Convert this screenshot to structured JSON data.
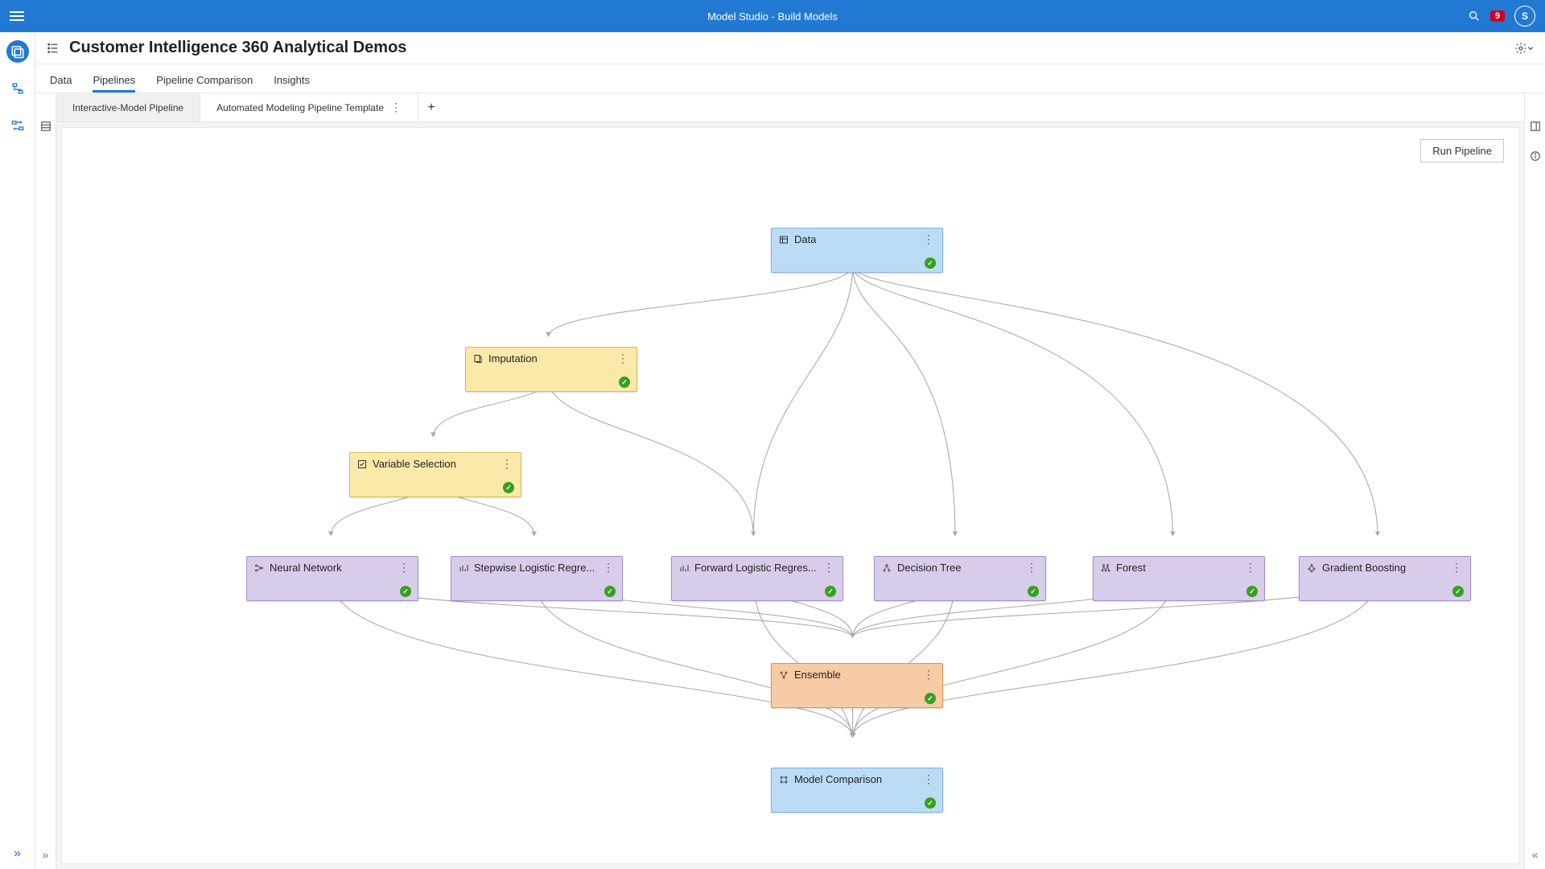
{
  "header": {
    "app_title": "Model Studio - Build Models",
    "notification_count": "9",
    "user_initial": "S"
  },
  "project": {
    "title": "Customer Intelligence 360 Analytical Demos"
  },
  "main_tabs": {
    "data": "Data",
    "pipelines": "Pipelines",
    "comparison": "Pipeline Comparison",
    "insights": "Insights"
  },
  "pipeline_tabs": {
    "tab1": "Interactive-Model Pipeline",
    "tab2": "Automated Modeling Pipeline Template"
  },
  "buttons": {
    "run": "Run Pipeline"
  },
  "nodes": {
    "data": "Data",
    "imputation": "Imputation",
    "varsel": "Variable Selection",
    "nn": "Neural Network",
    "swlr": "Stepwise Logistic Regre...",
    "fwlr": "Forward Logistic Regres...",
    "dt": "Decision Tree",
    "forest": "Forest",
    "gb": "Gradient Boosting",
    "ensemble": "Ensemble",
    "modelcomp": "Model Comparison"
  },
  "diagram": {
    "type": "pipeline-dag",
    "nodes": [
      {
        "id": "data",
        "label": "Data",
        "kind": "data",
        "status": "ok"
      },
      {
        "id": "imputation",
        "label": "Imputation",
        "kind": "prep",
        "status": "ok"
      },
      {
        "id": "varsel",
        "label": "Variable Selection",
        "kind": "prep",
        "status": "ok"
      },
      {
        "id": "nn",
        "label": "Neural Network",
        "kind": "model",
        "status": "ok"
      },
      {
        "id": "swlr",
        "label": "Stepwise Logistic Regression",
        "kind": "model",
        "status": "ok"
      },
      {
        "id": "fwlr",
        "label": "Forward Logistic Regression",
        "kind": "model",
        "status": "ok"
      },
      {
        "id": "dt",
        "label": "Decision Tree",
        "kind": "model",
        "status": "ok"
      },
      {
        "id": "forest",
        "label": "Forest",
        "kind": "model",
        "status": "ok"
      },
      {
        "id": "gb",
        "label": "Gradient Boosting",
        "kind": "model",
        "status": "ok"
      },
      {
        "id": "ensemble",
        "label": "Ensemble",
        "kind": "ensemble",
        "status": "ok"
      },
      {
        "id": "modelcomp",
        "label": "Model Comparison",
        "kind": "compare",
        "status": "ok"
      }
    ],
    "edges": [
      [
        "data",
        "imputation"
      ],
      [
        "data",
        "fwlr"
      ],
      [
        "data",
        "dt"
      ],
      [
        "data",
        "forest"
      ],
      [
        "data",
        "gb"
      ],
      [
        "imputation",
        "varsel"
      ],
      [
        "imputation",
        "fwlr"
      ],
      [
        "varsel",
        "nn"
      ],
      [
        "varsel",
        "swlr"
      ],
      [
        "nn",
        "ensemble"
      ],
      [
        "swlr",
        "ensemble"
      ],
      [
        "fwlr",
        "ensemble"
      ],
      [
        "dt",
        "ensemble"
      ],
      [
        "forest",
        "ensemble"
      ],
      [
        "gb",
        "ensemble"
      ],
      [
        "nn",
        "modelcomp"
      ],
      [
        "swlr",
        "modelcomp"
      ],
      [
        "fwlr",
        "modelcomp"
      ],
      [
        "dt",
        "modelcomp"
      ],
      [
        "forest",
        "modelcomp"
      ],
      [
        "gb",
        "modelcomp"
      ],
      [
        "ensemble",
        "modelcomp"
      ]
    ]
  }
}
